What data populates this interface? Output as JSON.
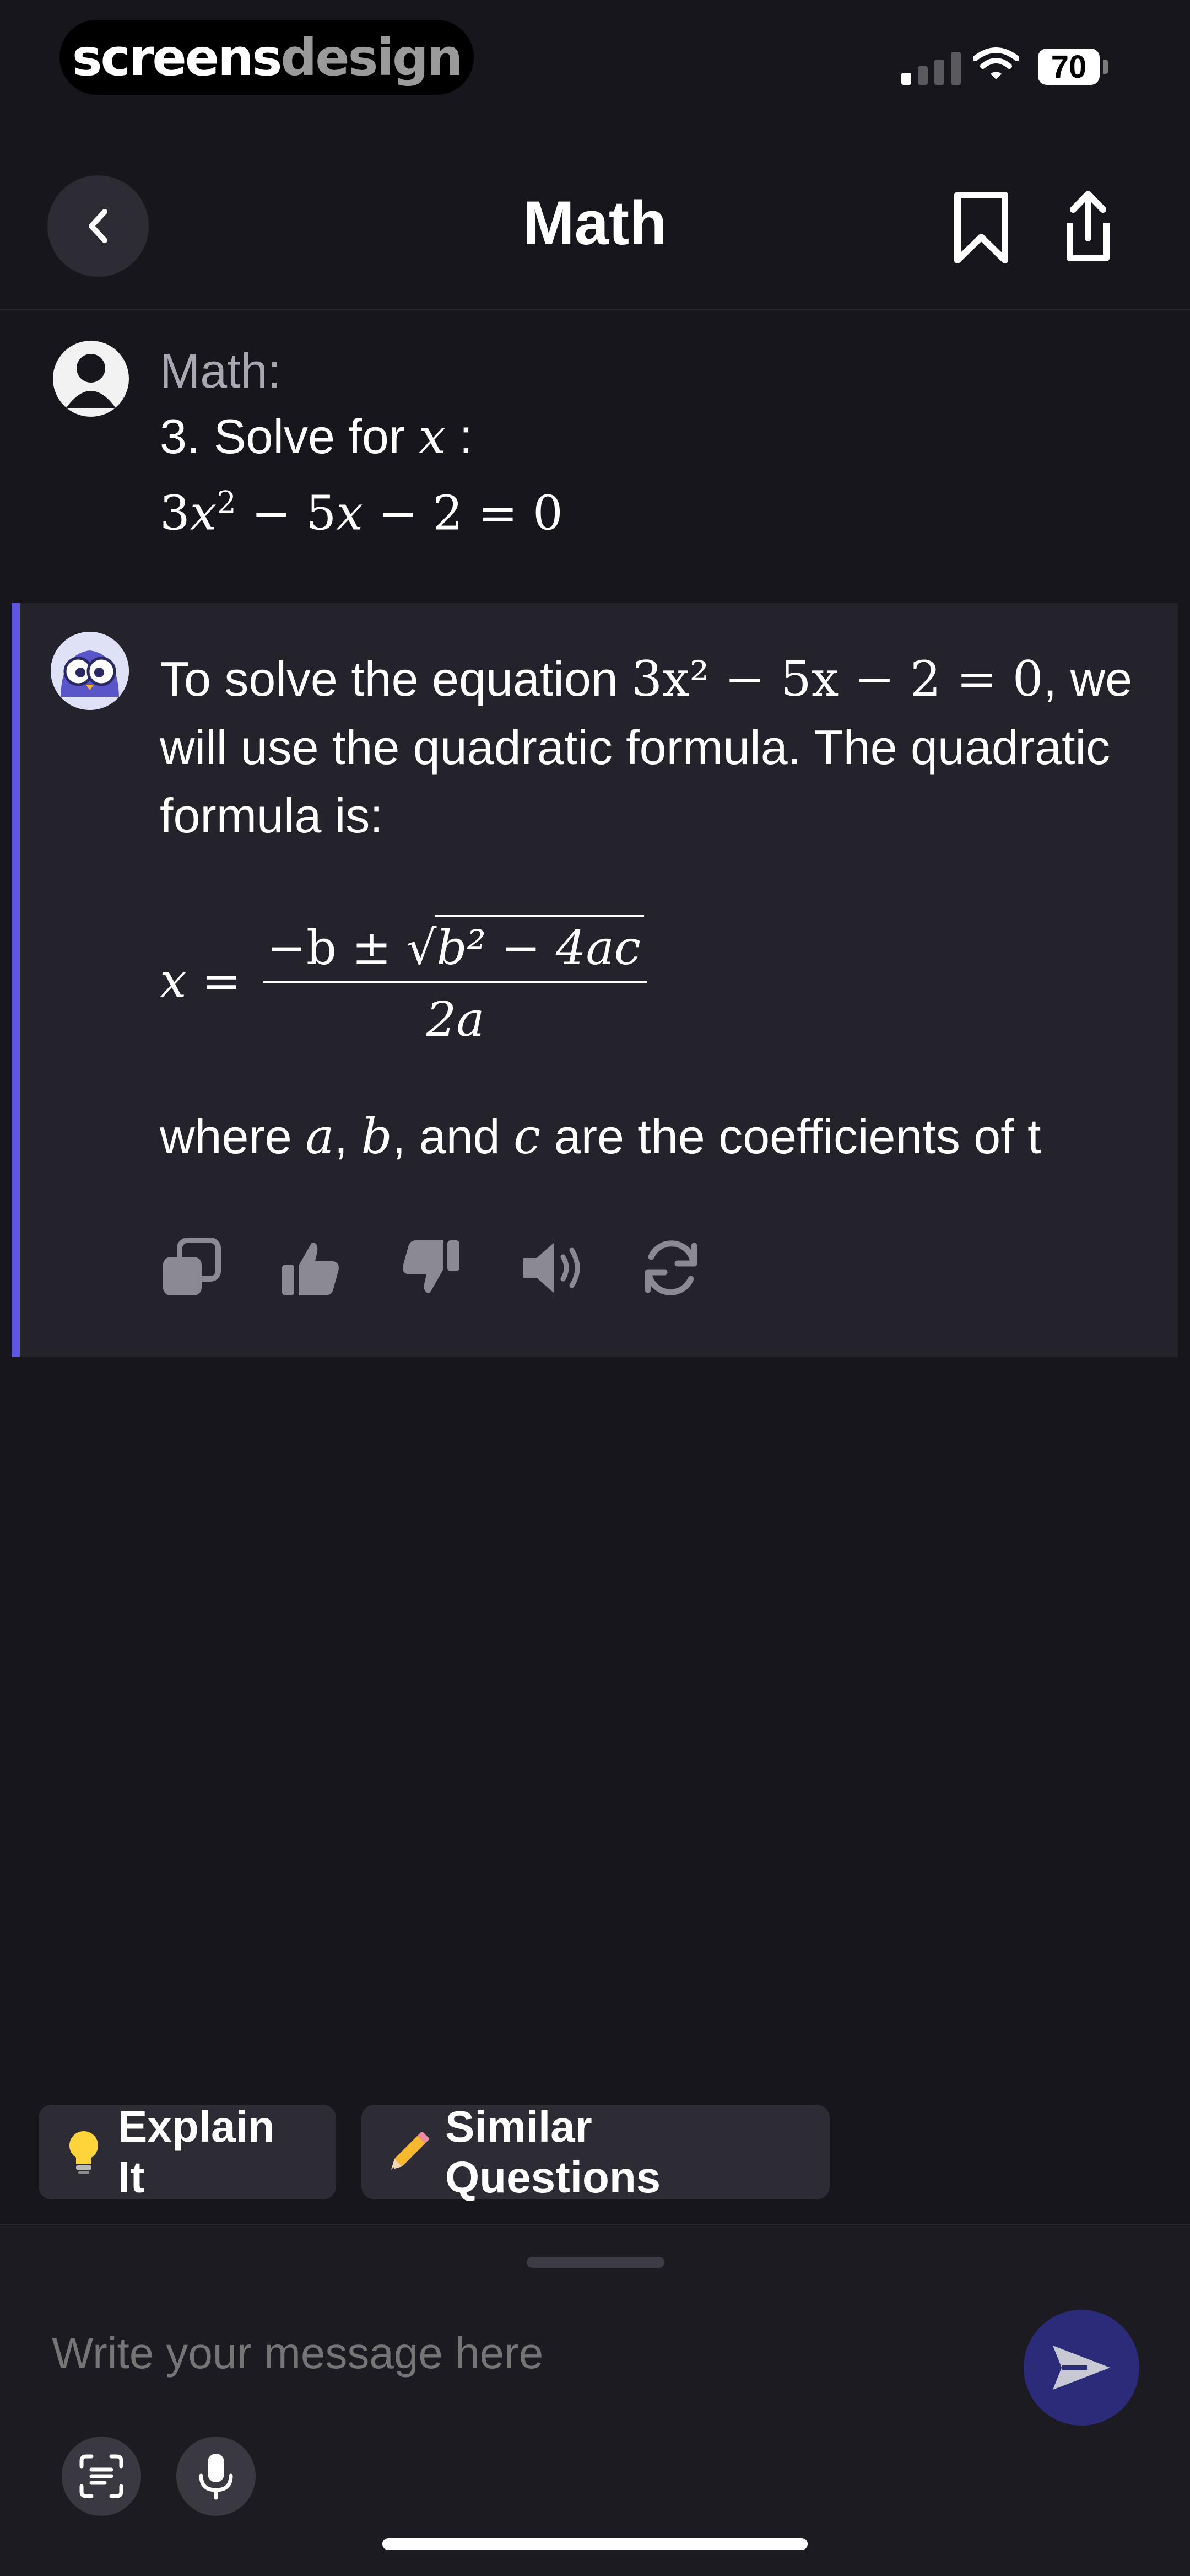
{
  "status_bar": {
    "brand_part1": "screens",
    "brand_part2": "design",
    "battery": "70"
  },
  "header": {
    "title": "Math"
  },
  "user_message": {
    "label": "Math:",
    "question_prefix": "3. Solve for ",
    "question_var": "x",
    "question_suffix": " :",
    "equation": {
      "coef": "3",
      "var": "x",
      "exp": "2",
      "rest": " − 5",
      "var2": "x",
      "tail": " − 2 = 0"
    }
  },
  "ai_message": {
    "intro_before": "To solve the equation ",
    "intro_equation": "3x² − 5x − 2 = 0",
    "intro_after": ", we will use the quadratic formula. The quadratic formula is:",
    "formula": {
      "lhs": "x =",
      "num_prefix": "−b ± √",
      "radicand": "b² − 4ac",
      "den": "2a"
    },
    "where_text_1": "where ",
    "where_a": "a",
    "where_sep1": ", ",
    "where_b": "b",
    "where_sep2": ", and ",
    "where_c": "c",
    "where_text_2": " are the coefficients of t"
  },
  "actions": [
    "copy-icon",
    "thumbs-up-icon",
    "thumbs-down-icon",
    "speaker-icon",
    "regenerate-icon"
  ],
  "suggestions": [
    {
      "label": "Explain It",
      "icon": "lightbulb-icon"
    },
    {
      "label": "Similar Questions",
      "icon": "pencil-icon"
    }
  ],
  "composer": {
    "placeholder": "Write your message here"
  },
  "colors": {
    "accent": "#5d56e4",
    "send_bg": "#2c2b7a",
    "background": "#18161d"
  }
}
